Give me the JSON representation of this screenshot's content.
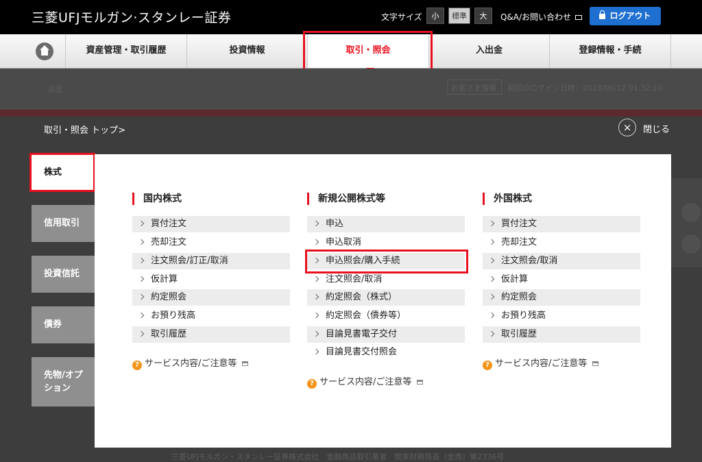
{
  "header": {
    "logo": "三菱UFJモルガン·スタンレー証券",
    "font_size_label": "文字サイズ",
    "font_sizes": [
      "小",
      "標準",
      "大"
    ],
    "qa_link": "Q&A/お問い合わせ",
    "logout": "ログアウト"
  },
  "nav": {
    "items": [
      "資産管理・取引履歴",
      "投資情報",
      "取引・照会",
      "入出金",
      "登録情報・手続"
    ],
    "active_index": 2
  },
  "background": {
    "settings": "設定",
    "greeting": "お客さま情報",
    "last_login": "前回のログイン日時：2018/06/12 01:32:10",
    "footer": "三菱UFJモルガン・スタンレー証券株式会社　金融商品取引業者　関東財務局長（金商）第2336号"
  },
  "panel": {
    "breadcrumb": "取引・照会 トップ>",
    "close_label": "閉じる",
    "close_icon": "×",
    "side_tabs": [
      "株式",
      "信用取引",
      "投資信託",
      "債券",
      "先物/オプ ション"
    ],
    "columns": [
      {
        "title": "国内株式",
        "links": [
          "買付注文",
          "売却注文",
          "注文照会/訂正/取消",
          "仮計算",
          "約定照会",
          "お預り残高",
          "取引履歴"
        ],
        "service": "サービス内容/ご注意等"
      },
      {
        "title": "新規公開株式等",
        "links": [
          "申込",
          "申込取消",
          "申込照会/購入手続",
          "注文照会/取消",
          "約定照会（株式）",
          "約定照会（債券等）",
          "目論見書電子交付",
          "目論見書交付照会"
        ],
        "service": "サービス内容/ご注意等"
      },
      {
        "title": "外国株式",
        "links": [
          "買付注文",
          "売却注文",
          "注文照会/取消",
          "仮計算",
          "約定照会",
          "お預り残高",
          "取引履歴"
        ],
        "service": "サービス内容/ご注意等"
      }
    ],
    "question_icon": "?"
  },
  "colors": {
    "accent_red": "#e8101f",
    "logout_blue": "#1e6fd0",
    "service_orange": "#f2951b"
  }
}
